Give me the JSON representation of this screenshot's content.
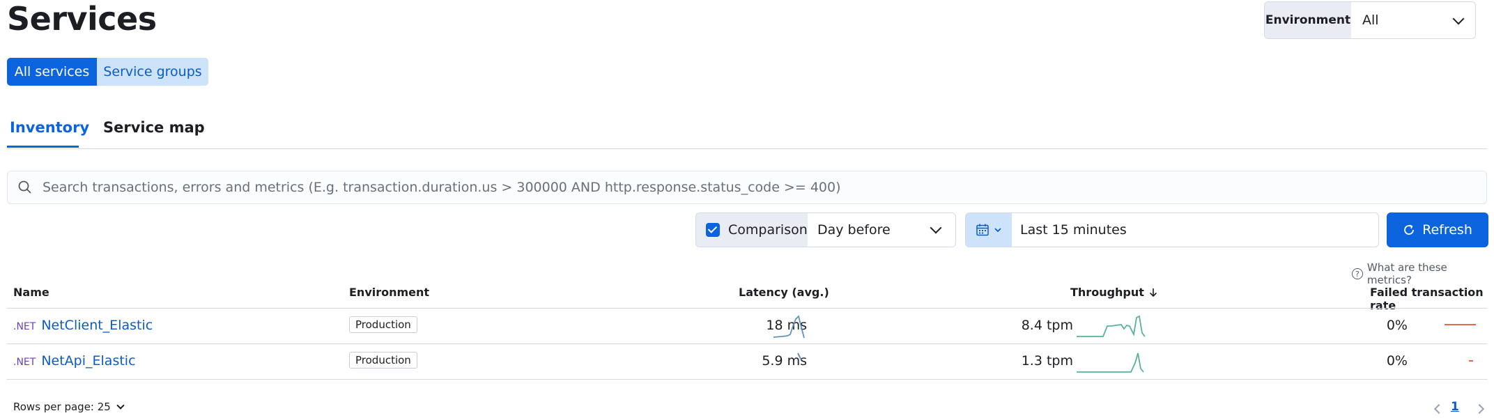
{
  "page": {
    "title": "Services"
  },
  "environment": {
    "label": "Environment",
    "value": "All"
  },
  "view_toggle": {
    "all_services": "All services",
    "service_groups": "Service groups"
  },
  "tabs": [
    {
      "label": "Inventory",
      "active": true
    },
    {
      "label": "Service map",
      "active": false
    }
  ],
  "search": {
    "placeholder": "Search transactions, errors and metrics (E.g. transaction.duration.us > 300000 AND http.response.status_code >= 400)"
  },
  "comparison": {
    "label": "Comparison",
    "checked": true,
    "value": "Day before"
  },
  "date_picker": {
    "value": "Last 15 minutes"
  },
  "refresh": {
    "label": "Refresh"
  },
  "metrics_help": {
    "label": "What are these metrics?"
  },
  "table": {
    "headers": {
      "name": "Name",
      "environment": "Environment",
      "latency": "Latency (avg.)",
      "throughput": "Throughput",
      "failed": "Failed transaction rate"
    },
    "sort": {
      "column": "Throughput",
      "direction": "descending"
    },
    "rows": [
      {
        "lang": ".NET",
        "name": "NetClient_Elastic",
        "environment": "Production",
        "latency": "18 ms",
        "throughput": "8.4 tpm",
        "failed": "0%"
      },
      {
        "lang": ".NET",
        "name": "NetApi_Elastic",
        "environment": "Production",
        "latency": "5.9 ms",
        "throughput": "1.3 tpm",
        "failed": "0%"
      }
    ]
  },
  "pagination": {
    "rows_per_page": "Rows per page: 25",
    "current_page": "1"
  },
  "colors": {
    "primary": "#0b64dd",
    "sparkline_latency": "#6092c0",
    "sparkline_throughput": "#54b399",
    "sparkline_failed": "#e7664c"
  }
}
